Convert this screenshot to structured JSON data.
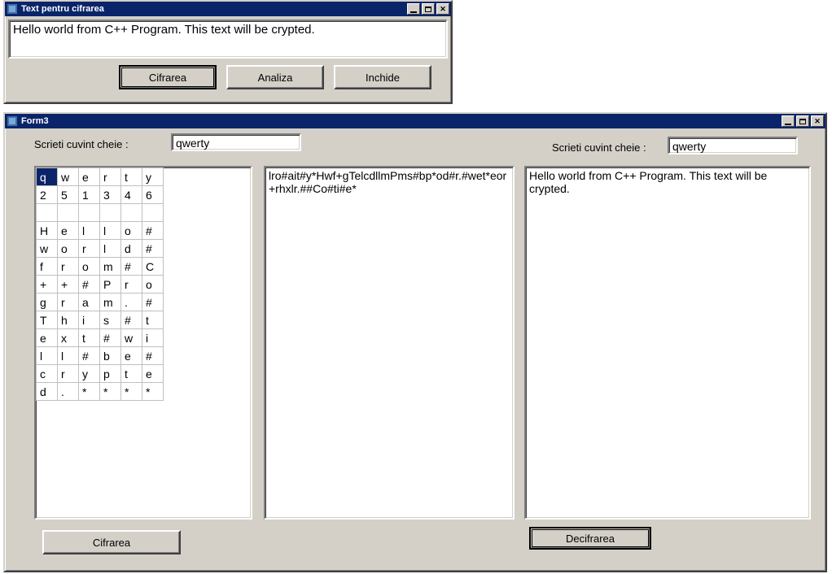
{
  "window1": {
    "title": "Text pentru cifrarea",
    "text": "Hello world from C++ Program. This text will be crypted.",
    "buttons": {
      "cifrarea": "Cifrarea",
      "analiza": "Analiza",
      "inchide": "Inchide"
    },
    "icon_name": "app-icon"
  },
  "window2": {
    "title": "Form3",
    "left": {
      "label": "Scrieti cuvint cheie :",
      "value": "qwerty"
    },
    "right": {
      "label": "Scrieti cuvint cheie :",
      "value": "qwerty"
    },
    "grid": {
      "rows": [
        [
          "q",
          "w",
          "e",
          "r",
          "t",
          "y"
        ],
        [
          "2",
          "5",
          "1",
          "3",
          "4",
          "6"
        ],
        [
          "",
          "",
          "",
          "",
          "",
          ""
        ],
        [
          "H",
          "e",
          "l",
          "l",
          "o",
          "#"
        ],
        [
          "w",
          "o",
          "r",
          "l",
          "d",
          "#"
        ],
        [
          "f",
          "r",
          "o",
          "m",
          "#",
          "C"
        ],
        [
          "+",
          "+",
          "#",
          "P",
          "r",
          "o"
        ],
        [
          "g",
          "r",
          "a",
          "m",
          ".",
          "#"
        ],
        [
          "T",
          "h",
          "i",
          "s",
          "#",
          "t"
        ],
        [
          "e",
          "x",
          "t",
          "#",
          "w",
          "i"
        ],
        [
          "l",
          "l",
          "#",
          "b",
          "e",
          "#"
        ],
        [
          "c",
          "r",
          "y",
          "p",
          "t",
          "e"
        ],
        [
          "d",
          ".",
          "*",
          "*",
          "*",
          "*"
        ]
      ],
      "selected": {
        "row": 0,
        "col": 0
      }
    },
    "cipher_text": "lro#ait#y*Hwf+gTelcdllmPms#bp*od#r.#wet*eor+rhxlr.##Co#ti#e*",
    "plain_text": "Hello world from C++ Program. This text will be crypted.",
    "buttons": {
      "cifrarea": "Cifrarea",
      "decifrarea": "Decifrarea"
    },
    "icon_name": "app-icon"
  }
}
